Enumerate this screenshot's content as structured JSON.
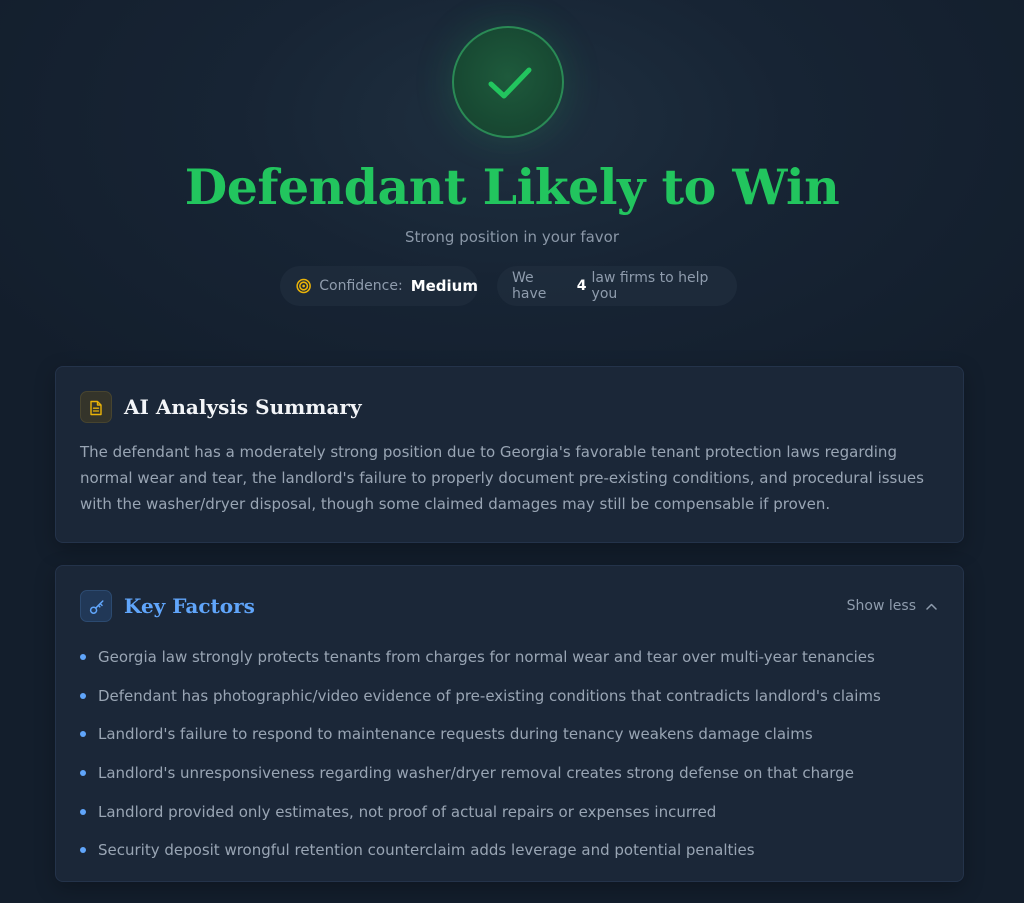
{
  "hero": {
    "title": "Defendant Likely to Win",
    "subtitle": "Strong position in your favor",
    "confidence_label": "Confidence:",
    "confidence_value": "Medium",
    "firms_prefix": "We have",
    "firms_count": "4",
    "firms_suffix": "law firms to help you",
    "icons": {
      "status": "check-icon",
      "confidence": "target-icon"
    }
  },
  "summary": {
    "title": "AI Analysis Summary",
    "icon": "document-icon",
    "text": "The defendant has a moderately strong position due to Georgia's favorable tenant protection laws regarding normal wear and tear, the landlord's failure to properly document pre-existing conditions, and procedural issues with the washer/dryer disposal, though some claimed damages may still be compensable if proven."
  },
  "key_factors": {
    "title": "Key Factors",
    "icon": "key-icon",
    "toggle_label": "Show less",
    "items": [
      "Georgia law strongly protects tenants from charges for normal wear and tear over multi-year tenancies",
      "Defendant has photographic/video evidence of pre-existing conditions that contradicts landlord's claims",
      "Landlord's failure to respond to maintenance requests during tenancy weakens damage claims",
      "Landlord's unresponsiveness regarding washer/dryer removal creates strong defense on that charge",
      "Landlord provided only estimates, not proof of actual repairs or expenses incurred",
      "Security deposit wrongful retention counterclaim adds leverage and potential penalties"
    ]
  },
  "colors": {
    "success": "#22c55e",
    "accent_blue": "#60a5fa",
    "confidence_amber": "#eab308",
    "background": "#141f2d",
    "card": "#1b2738"
  }
}
